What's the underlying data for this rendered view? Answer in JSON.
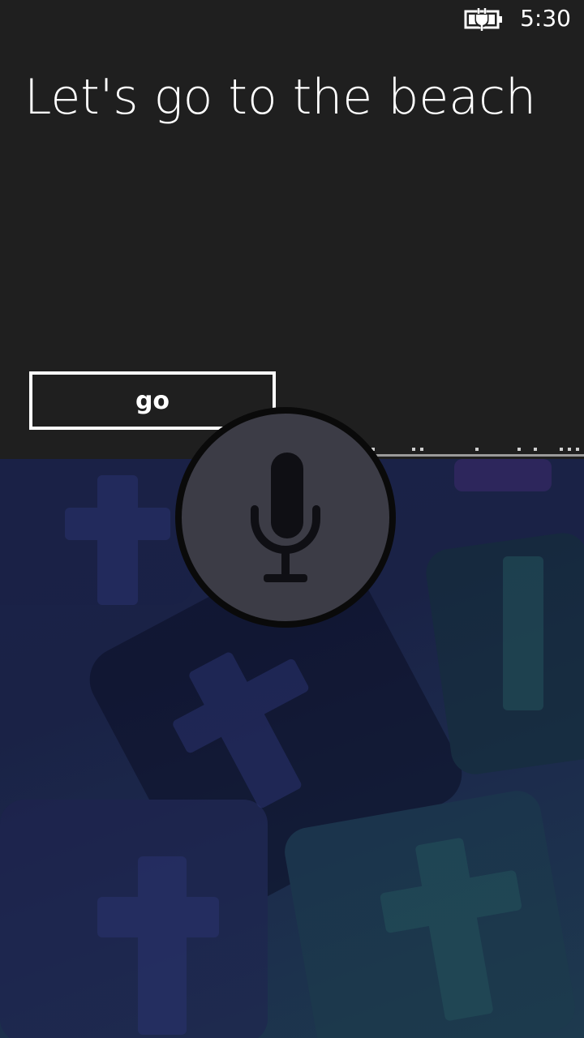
{
  "status_bar": {
    "time": "5:30",
    "battery_icon": "battery-charging-icon"
  },
  "speech": {
    "utterance": "Let's go to the beach"
  },
  "actions": {
    "go_label": "go"
  },
  "mic": {
    "icon": "microphone-icon"
  },
  "colors": {
    "panel": "#1f1f1f",
    "text": "#ffffff",
    "mic_fill": "#3a3a44",
    "mic_ring": "#0a0a0a"
  }
}
